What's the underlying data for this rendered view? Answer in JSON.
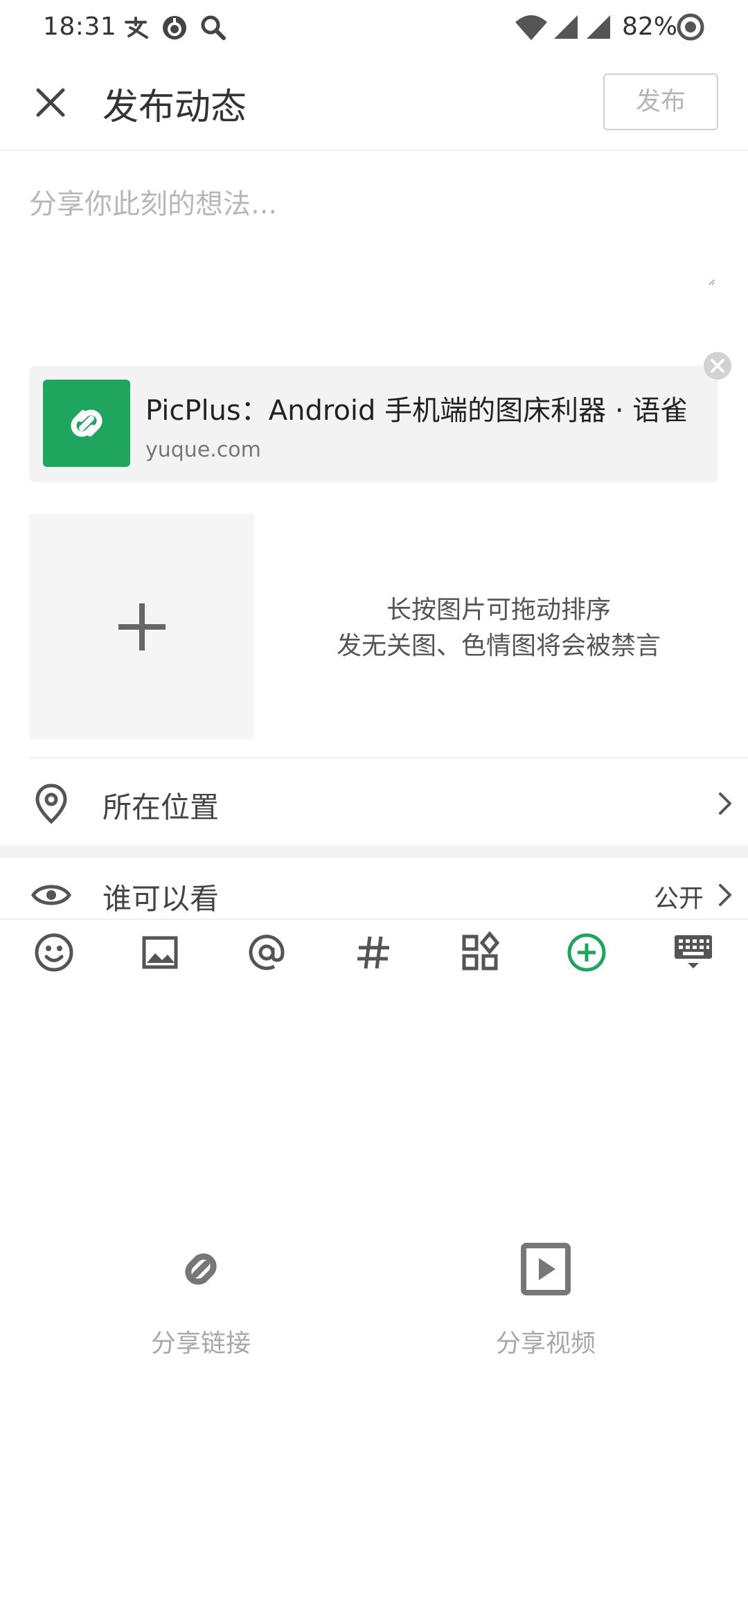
{
  "status_bar": {
    "time": "18:31",
    "battery": "82%"
  },
  "header": {
    "title": "发布动态",
    "publish_label": "发布"
  },
  "editor": {
    "placeholder": "分享你此刻的想法..."
  },
  "link_card": {
    "title": "PicPlus：Android 手机端的图床利器 · 语雀",
    "domain": "yuque.com"
  },
  "image_hint": {
    "line1": "长按图片可拖动排序",
    "line2": "发无关图、色情图将会被禁言"
  },
  "location": {
    "label": "所在位置"
  },
  "visibility": {
    "label": "谁可以看",
    "value": "公开"
  },
  "toolbar": {
    "icons": [
      "emoji-icon",
      "image-icon",
      "at-icon",
      "hashtag-icon",
      "apps-icon",
      "plus-circle-icon",
      "keyboard-icon"
    ],
    "active": "plus-circle-icon"
  },
  "share_options": [
    {
      "label": "分享链接",
      "icon": "link-icon"
    },
    {
      "label": "分享视频",
      "icon": "video-icon"
    }
  ],
  "colors": {
    "accent": "#1fa55e",
    "muted": "#a8a8a8",
    "background": "#ffffff"
  }
}
